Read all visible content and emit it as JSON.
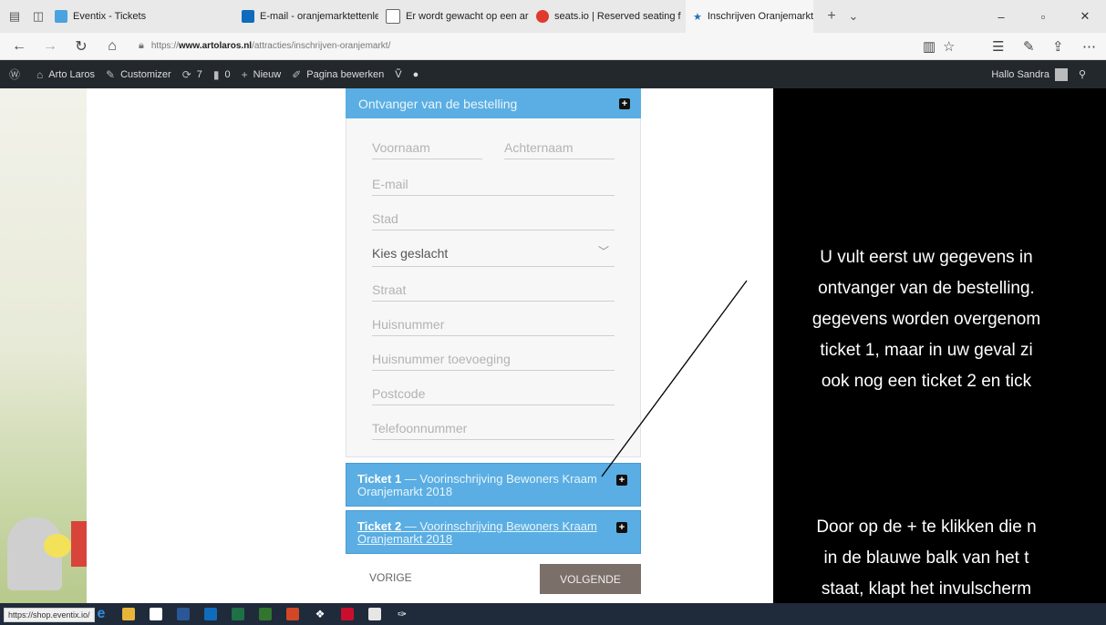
{
  "browser": {
    "tabs": [
      {
        "label": "Eventix - Tickets",
        "color": "#4aa3df"
      },
      {
        "label": "E-mail - oranjemarktettenle",
        "color": "#0f6cbd"
      },
      {
        "label": "Er wordt gewacht op een ar",
        "color": "#666666"
      },
      {
        "label": "seats.io | Reserved seating f",
        "color": "#e03a2f"
      },
      {
        "label": "Inschrijven Oranjemarkt",
        "color": "#1e73be"
      }
    ],
    "active_tab_index": 4,
    "url_prefix": "https://",
    "url_domain": "www.artolaros.nl",
    "url_path": "/attracties/inschrijven-oranjemarkt/"
  },
  "wpbar": {
    "site": "Arto Laros",
    "customizer": "Customizer",
    "updates": "7",
    "comments": "0",
    "new": "Nieuw",
    "edit": "Pagina bewerken",
    "greeting": "Hallo Sandra"
  },
  "form": {
    "section_title": "Ontvanger van de bestelling",
    "fields": {
      "firstname": "Voornaam",
      "lastname": "Achternaam",
      "email": "E-mail",
      "city": "Stad",
      "gender": "Kies geslacht",
      "street": "Straat",
      "housenumber": "Huisnummer",
      "housenumber_add": "Huisnummer toevoeging",
      "postcode": "Postcode",
      "phone": "Telefoonnummer"
    },
    "tickets": [
      {
        "name": "Ticket 1",
        "desc": " — Voorinschrijving Bewoners Kraam Oranjemarkt 2018"
      },
      {
        "name": "Ticket 2",
        "desc": " — Voorinschrijving Bewoners Kraam Oranjemarkt 2018"
      }
    ],
    "prev": "VORIGE",
    "next": "VOLGENDE"
  },
  "annotation": {
    "lines": [
      "U vult eerst uw gegevens in",
      "ontvanger van de bestelling.",
      "gegevens worden overgenom",
      "ticket 1, maar in uw geval zi",
      "ook nog een ticket 2 en tick",
      "Door op de + te klikken die n",
      "in de blauwe balk van het t",
      "staat, klapt het invulscherm"
    ]
  },
  "status_url": "https://shop.eventix.io/"
}
